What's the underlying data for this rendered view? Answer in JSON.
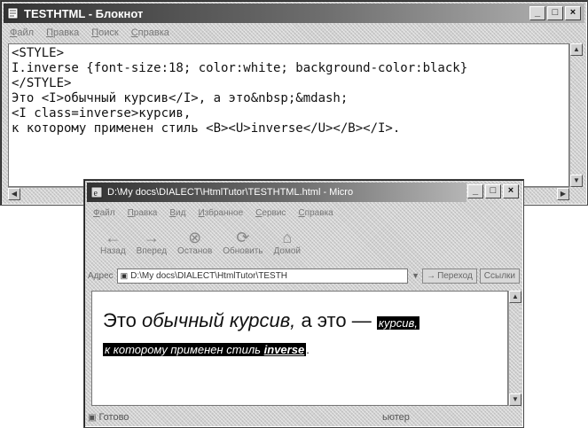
{
  "notepad": {
    "title": "TESTHTML - Блокнот",
    "menu": [
      "Файл",
      "Правка",
      "Поиск",
      "Справка"
    ],
    "lines": [
      "<STYLE>",
      "I.inverse {font-size:18; color:white; background-color:black}",
      "</STYLE>",
      "",
      "Это <I>обычный курсив</I>, а это&nbsp;&mdash;",
      "<I class=inverse>курсив,",
      "к которому применен стиль <B><U>inverse</U></B></I>."
    ]
  },
  "browser": {
    "title": "D:\\My docs\\DIALECT\\HtmlTutor\\TESTHTML.html - Micro",
    "menu": [
      "Файл",
      "Правка",
      "Вид",
      "Избранное",
      "Сервис",
      "Справка"
    ],
    "toolbar": {
      "back": "Назад",
      "forward": "Вперед",
      "stop": "Останов",
      "refresh": "Обновить",
      "home": "Домой"
    },
    "address": {
      "label": "Адрес",
      "value": "D:\\My docs\\DIALECT\\HtmlTutor\\TESTH",
      "go": "Переход",
      "links": "Ссылки"
    },
    "page": {
      "normal_text": "Это",
      "italic_text": "обычный курсив,",
      "middle_text": "а это —",
      "inverse_first": "курсив,",
      "inverse_line": "к которому применен стиль",
      "inverse_bold": "inverse",
      "period": "."
    },
    "status": {
      "ready": "Готово",
      "zone": "ьютер"
    }
  }
}
